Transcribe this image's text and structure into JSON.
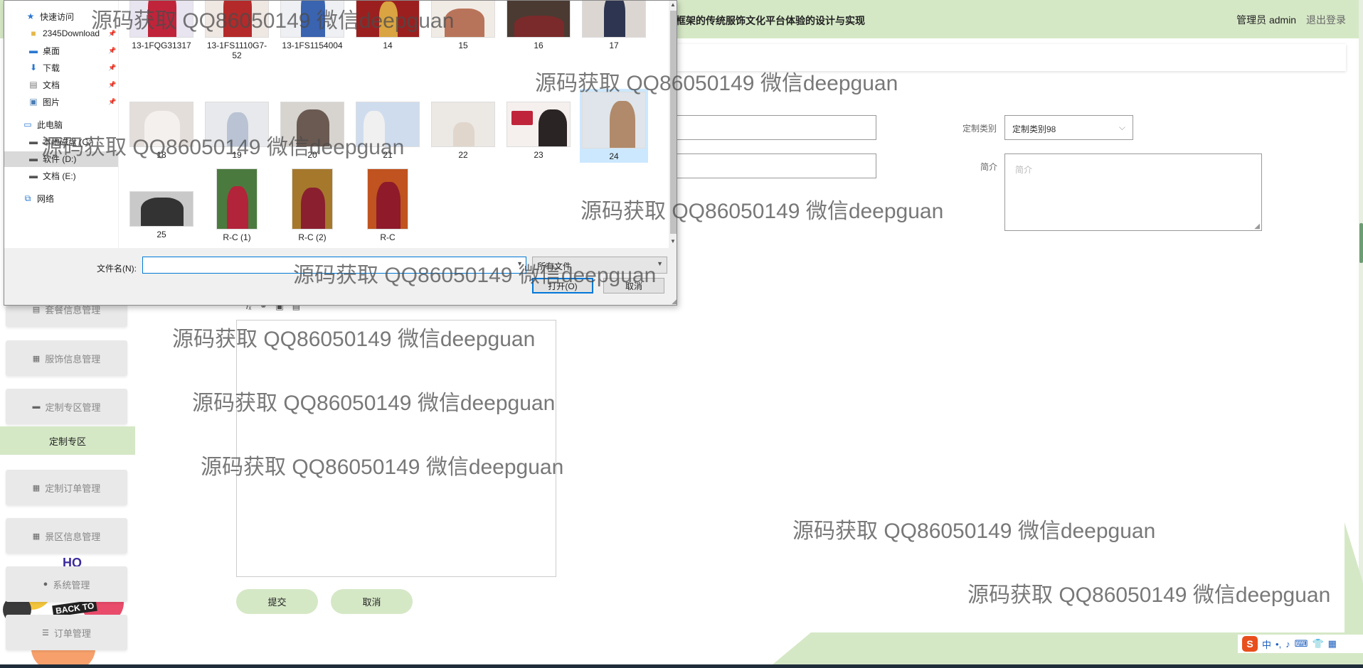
{
  "app": {
    "title": "框架的传统服饰文化平台体验的设计与实现",
    "user": "管理员 admin",
    "logout": "退出登录"
  },
  "sidebar": {
    "items": [
      {
        "label": "套餐信息管理",
        "icon": "document-icon"
      },
      {
        "label": "服饰信息管理",
        "icon": "grid-icon"
      },
      {
        "label": "定制专区管理",
        "icon": "monitor-icon"
      },
      {
        "label": "定制订单管理",
        "icon": "grid-icon"
      },
      {
        "label": "景区信息管理",
        "icon": "grid-icon"
      },
      {
        "label": "系统管理",
        "icon": "pin-icon"
      },
      {
        "label": "订单管理",
        "icon": "list-icon"
      }
    ],
    "active": "定制专区",
    "deco_text": "BACK TO",
    "deco_ho": "HO"
  },
  "form": {
    "category_label": "定制类别",
    "category_value": "定制类别98",
    "intro_label": "简介",
    "intro_placeholder": "简介",
    "submit": "提交",
    "cancel": "取消"
  },
  "dialog": {
    "nav": [
      {
        "label": "快速访问",
        "icon": "star-icon",
        "pinned": false
      },
      {
        "label": "2345Download",
        "icon": "folder-icon",
        "pinned": true
      },
      {
        "label": "桌面",
        "icon": "desktop-icon",
        "pinned": true
      },
      {
        "label": "下载",
        "icon": "download-icon",
        "pinned": true
      },
      {
        "label": "文档",
        "icon": "document-icon",
        "pinned": true
      },
      {
        "label": "图片",
        "icon": "picture-icon",
        "pinned": true
      },
      {
        "label": "此电脑",
        "icon": "computer-icon",
        "pinned": false
      },
      {
        "label": "本地磁盘 (C:)",
        "icon": "drive-icon",
        "pinned": false
      },
      {
        "label": "软件 (D:)",
        "icon": "drive-icon",
        "pinned": false
      },
      {
        "label": "文档 (E:)",
        "icon": "drive-icon",
        "pinned": false
      },
      {
        "label": "网络",
        "icon": "network-icon",
        "pinned": false
      }
    ],
    "files": [
      "13-1FQG31317",
      "13-1FS1110G7-52",
      "13-1FS1154004",
      "14",
      "15",
      "16",
      "17",
      "18",
      "19",
      "20",
      "21",
      "22",
      "23",
      "24",
      "25",
      "R-C (1)",
      "R-C (2)",
      "R-C"
    ],
    "selected_file": "24",
    "filename_label": "文件名(N):",
    "filename_value": "",
    "filetype": "所有文件",
    "open": "打开(O)",
    "cancel": "取消"
  },
  "watermark": "源码获取 QQ86050149 微信deepguan",
  "colors": {
    "accent": "#d5e8c6",
    "selection": "#cce8ff",
    "focus": "#0078d7"
  }
}
